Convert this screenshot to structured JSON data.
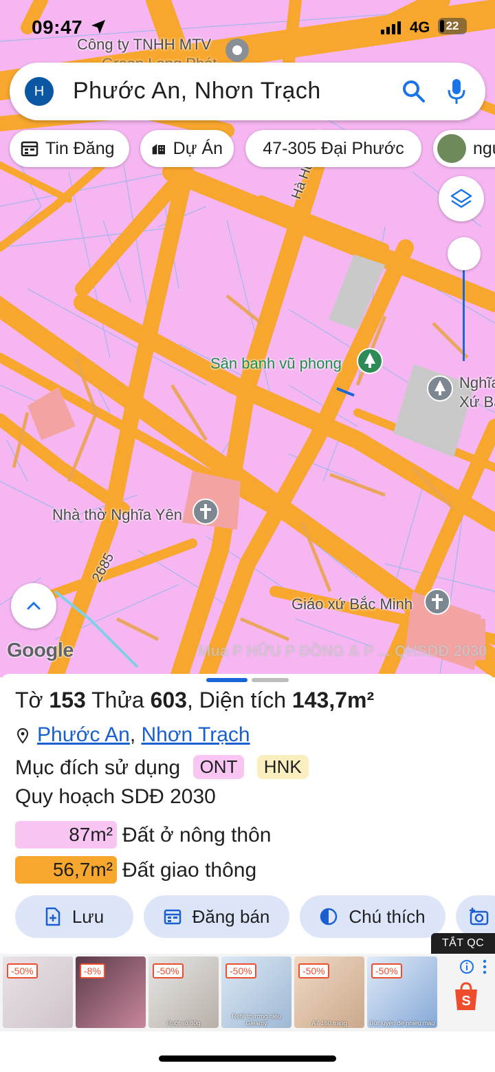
{
  "status_bar": {
    "time": "09:47",
    "network": "4G",
    "battery": "22"
  },
  "search": {
    "avatar_letter": "H",
    "query": "Phước An, Nhơn Trạch"
  },
  "chips": [
    {
      "label": "Tin Đăng",
      "icon": "calendar-icon"
    },
    {
      "label": "Dự Án",
      "icon": "buildings-icon"
    },
    {
      "label": "47-305 Đại Phước"
    },
    {
      "label": "ngu"
    }
  ],
  "map": {
    "labels": {
      "company_1": "Công ty TNHH MTV",
      "company_2": "Green Long Phát",
      "street": "Hà Huy Tập",
      "field": "Sân banh vũ phong",
      "cemetery_1": "Nghĩa",
      "cemetery_2": "Xứ Bắ",
      "church_1": "Nhà thờ Nghĩa Yên",
      "church_2": "Giáo xứ Bắc Minh",
      "road_number": "2685"
    },
    "google": "Google",
    "watermark": "Mua P HỮU P ĐỒNG & P ... QHSDĐ 2030"
  },
  "parcel": {
    "to_label": "Tờ",
    "to_value": "153",
    "thua_label": "Thửa",
    "thua_value": "603",
    "area_label": "Diện tích",
    "area_value": "143,7m²",
    "ward": "Phước An",
    "district": "Nhơn Trạch",
    "purpose_label": "Mục đích sử dụng",
    "purpose_tags": [
      "ONT",
      "HNK"
    ],
    "planning_title": "Quy hoạch SDĐ 2030",
    "planning_rows": [
      {
        "area": "87m²",
        "desc": "Đất ở nông thôn",
        "color": "#f9c6f4"
      },
      {
        "area": "56,7m²",
        "desc": "Đất giao thông",
        "color": "#f7a72e"
      }
    ]
  },
  "actions": {
    "save": "Lưu",
    "post": "Đăng bán",
    "legend": "Chú thích"
  },
  "ad": {
    "close_label": "TẮT QC",
    "items": [
      {
        "discount": "-50%",
        "caption": ""
      },
      {
        "discount": "-8%",
        "caption": ""
      },
      {
        "discount": "-50%",
        "caption": "Ruột sổ 80g"
      },
      {
        "discount": "-50%",
        "caption": "Refill thương hiệu Gleamy"
      },
      {
        "discount": "-50%",
        "caption": "A7 160 trang"
      },
      {
        "discount": "-50%",
        "caption": "Bút luyện đề nhiều màu"
      }
    ]
  },
  "colors": {
    "land_residential": "#f6b6f2",
    "roads": "#f7a72e",
    "accent_blue": "#1a5fcf"
  }
}
